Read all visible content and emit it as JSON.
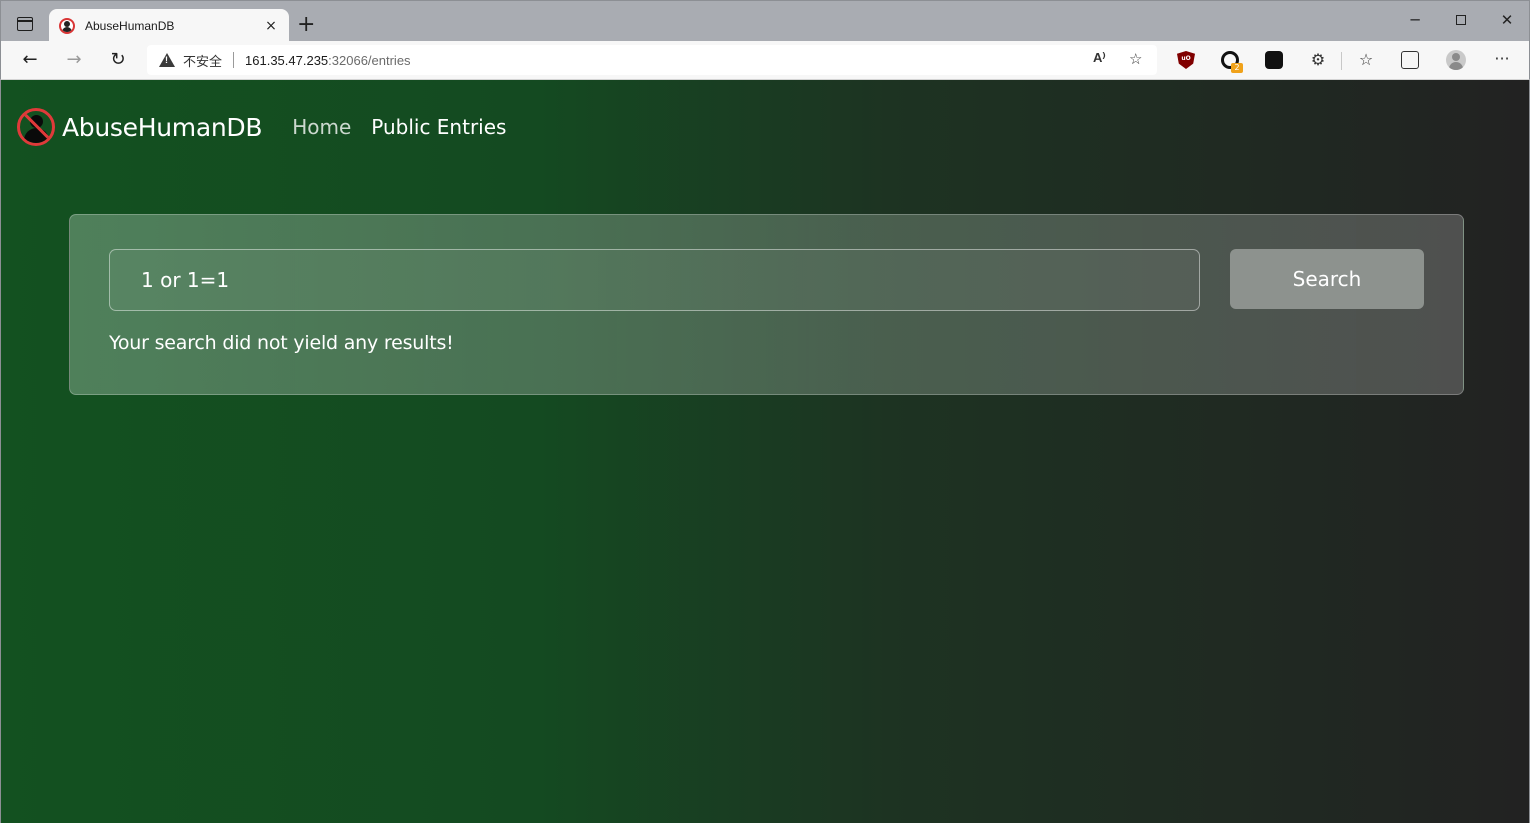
{
  "browser": {
    "tab": {
      "title": "AbuseHumanDB",
      "close": "×"
    },
    "new_tab": "+",
    "window": {
      "minimize": "─",
      "close": "✕"
    },
    "nav": {
      "back": "←",
      "forward": "→",
      "reload": "↻"
    },
    "address": {
      "insecure_label": "不安全",
      "host": "161.35.47.235",
      "path": ":32066/entries"
    },
    "icons": {
      "read_aloud": "A⁾",
      "favorite": "☆",
      "puzzle": "⚙",
      "favorites": "☆",
      "more": "···",
      "ublock_badge": "uO",
      "ext_badge_count": "2"
    }
  },
  "site": {
    "brand": "AbuseHumanDB",
    "nav": [
      {
        "label": "Home"
      },
      {
        "label": "Public Entries"
      }
    ]
  },
  "search": {
    "query": "1 or 1=1",
    "button_label": "Search",
    "result_message": "Your search did not yield any results!"
  },
  "colors": {
    "accent_red": "#e03a3a",
    "bg_green": "#135120",
    "bg_dark": "#222222"
  }
}
